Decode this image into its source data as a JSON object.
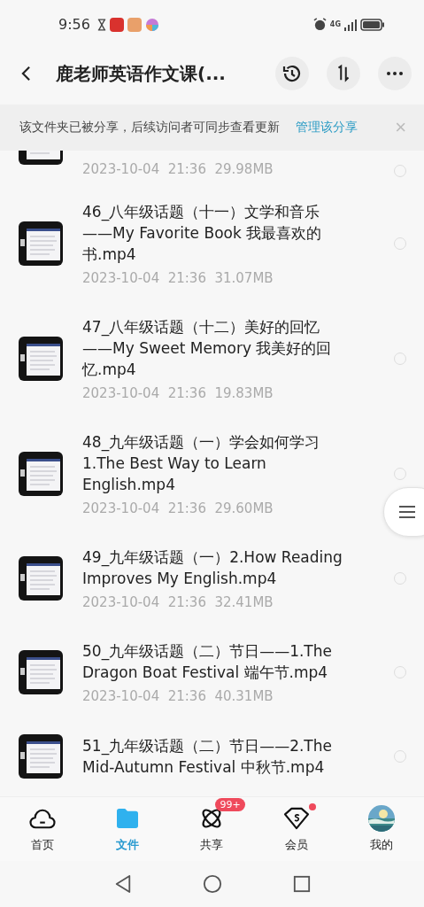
{
  "status_bar": {
    "time": "9:56",
    "network": "4G"
  },
  "header": {
    "title": "鹿老师英语作文课(..."
  },
  "share_banner": {
    "text": "该文件夹已被分享，后续访问者可同步查看更新",
    "link": "管理该分享",
    "close": "×"
  },
  "files": [
    {
      "kind": "partial",
      "meta": "2023-10-04  21:36  29.98MB",
      "selected": false
    },
    {
      "kind": "full",
      "name": "46_八年级话题（十一）文学和音乐——My Favorite Book 我最喜欢的书.mp4",
      "meta": "2023-10-04  21:36  31.07MB",
      "selected": false
    },
    {
      "kind": "full",
      "name": "47_八年级话题（十二）美好的回忆——My Sweet Memory 我美好的回忆.mp4",
      "meta": "2023-10-04  21:36  19.83MB",
      "selected": false
    },
    {
      "kind": "full",
      "name": "48_九年级话题（一）学会如何学习1.The Best Way to Learn English.mp4",
      "meta": "2023-10-04  21:36  29.60MB",
      "selected": false
    },
    {
      "kind": "full",
      "name": "49_九年级话题（一）2.How Reading Improves My English.mp4",
      "meta": "2023-10-04  21:36  32.41MB",
      "selected": false
    },
    {
      "kind": "full",
      "name": "50_九年级话题（二）节日——1.The Dragon Boat Festival 端午节.mp4",
      "meta": "2023-10-04  21:36  40.31MB",
      "selected": false
    },
    {
      "kind": "full",
      "name": "51_九年级话题（二）节日——2.The Mid-Autumn Festival 中秋节.mp4",
      "selected": false
    }
  ],
  "bottom_nav": [
    {
      "kind": "home",
      "label": "首页",
      "selected": false
    },
    {
      "kind": "files",
      "label": "文件",
      "selected": true
    },
    {
      "kind": "share",
      "label": "共享",
      "selected": false,
      "badge": "99+"
    },
    {
      "kind": "vip",
      "label": "会员",
      "selected": false,
      "dot": true
    },
    {
      "kind": "me",
      "label": "我的",
      "selected": false
    }
  ]
}
